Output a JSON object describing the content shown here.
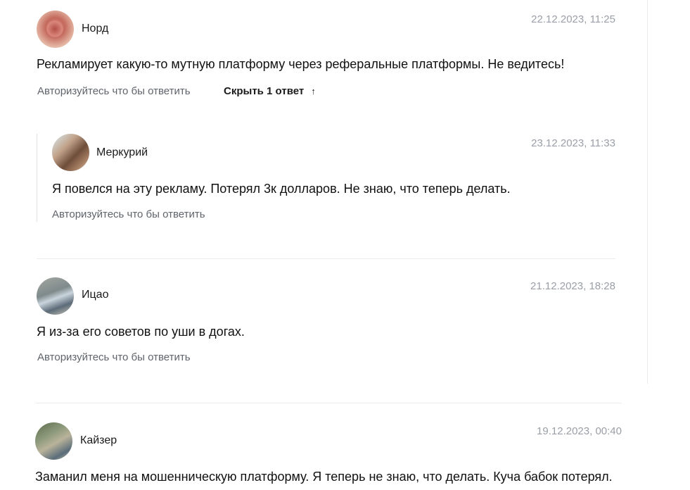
{
  "comments": [
    {
      "author": "Норд",
      "date": "22.12.2023, 11:25",
      "text": "Рекламирует какую-то мутную платформу через реферальные платформы. Не ведитесь!",
      "reply_link": "Авторизуйтесь что бы ответить",
      "toggle_label": "Скрыть 1 ответ",
      "toggle_icon": "arrow-up-icon",
      "avatar_icon": "user-avatar",
      "replies": [
        {
          "author": "Меркурий",
          "date": "23.12.2023, 11:33",
          "text": "Я повелся на эту рекламу. Потерял 3к долларов. Не знаю, что теперь делать.",
          "reply_link": "Авторизуйтесь что бы ответить",
          "avatar_icon": "user-avatar"
        }
      ]
    },
    {
      "author": "Ицао",
      "date": "21.12.2023, 18:28",
      "text": "Я из-за его советов по уши в догах.",
      "reply_link": "Авторизуйтесь что бы ответить",
      "avatar_icon": "user-avatar"
    },
    {
      "author": "Кайзер",
      "date": "19.12.2023, 00:40",
      "text": "Заманил меня на мошенническую платформу. Я теперь не знаю, что делать. Куча бабок потерял.",
      "avatar_icon": "user-avatar"
    }
  ],
  "colors": {
    "date": "#9a9ea6",
    "reply_link": "#5f646b",
    "divider": "#ececec"
  }
}
